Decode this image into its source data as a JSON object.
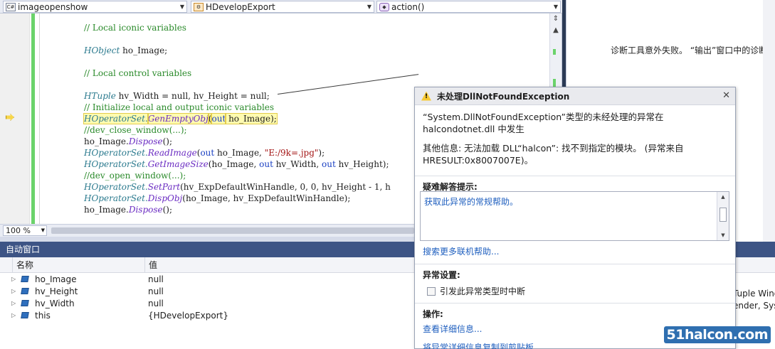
{
  "navbar": {
    "project": "imageopenshow",
    "class": "HDevelopExport",
    "method": "action()"
  },
  "editor": {
    "code_lines": [
      [
        {
          "t": "// Local iconic variables",
          "c": "cm"
        }
      ],
      [],
      [
        {
          "t": "HObject",
          "c": "ty"
        },
        {
          "t": " ho_Image;",
          "c": ""
        }
      ],
      [],
      [
        {
          "t": "// Local control variables",
          "c": "cm"
        }
      ],
      [],
      [
        {
          "t": "HTuple",
          "c": "ty"
        },
        {
          "t": " hv_Width = null, hv_Height = null;",
          "c": ""
        }
      ],
      [
        {
          "t": "// Initialize local and output iconic variables",
          "c": "cm"
        }
      ],
      [
        {
          "t": "HOperatorSet.",
          "c": "ty hl"
        },
        {
          "t": "GenEmptyObj",
          "c": "fn hl"
        },
        {
          "t": "(",
          "c": "hl"
        },
        {
          "t": "out",
          "c": "kw hl"
        },
        {
          "t": " ho_Image);",
          "c": "hl"
        }
      ],
      [
        {
          "t": "//dev_close_window(...);",
          "c": "cm"
        }
      ],
      [
        {
          "t": "ho_Image.",
          "c": ""
        },
        {
          "t": "Dispose",
          "c": "fn"
        },
        {
          "t": "();",
          "c": ""
        }
      ],
      [
        {
          "t": "HOperatorSet.",
          "c": "ty"
        },
        {
          "t": "ReadImage",
          "c": "fn"
        },
        {
          "t": "(",
          "c": ""
        },
        {
          "t": "out",
          "c": "kw"
        },
        {
          "t": " ho_Image, ",
          "c": ""
        },
        {
          "t": "\"E:/9k=.jpg\"",
          "c": "st"
        },
        {
          "t": ");",
          "c": ""
        }
      ],
      [
        {
          "t": "HOperatorSet.",
          "c": "ty"
        },
        {
          "t": "GetImageSize",
          "c": "fn"
        },
        {
          "t": "(ho_Image, ",
          "c": ""
        },
        {
          "t": "out",
          "c": "kw"
        },
        {
          "t": " hv_Width, ",
          "c": ""
        },
        {
          "t": "out",
          "c": "kw"
        },
        {
          "t": " hv_Height);",
          "c": ""
        }
      ],
      [
        {
          "t": "//dev_open_window(...);",
          "c": "cm"
        }
      ],
      [
        {
          "t": "HOperatorSet.",
          "c": "ty"
        },
        {
          "t": "SetPart",
          "c": "fn"
        },
        {
          "t": "(hv_ExpDefaultWinHandle, 0, 0, hv_Height - 1, h",
          "c": ""
        }
      ],
      [
        {
          "t": "HOperatorSet.",
          "c": "ty"
        },
        {
          "t": "DispObj",
          "c": "fn"
        },
        {
          "t": "(ho_Image, hv_ExpDefaultWinHandle);",
          "c": ""
        }
      ],
      [
        {
          "t": "ho_Image.",
          "c": ""
        },
        {
          "t": "Dispose",
          "c": "fn"
        },
        {
          "t": "();",
          "c": ""
        }
      ]
    ],
    "zoom": "100 %"
  },
  "right_pane": {
    "diagnostic_text": "诊断工具意外失败。 “输出”窗口中的诊断"
  },
  "autos": {
    "title": "自动窗口",
    "col_name": "名称",
    "col_value": "值",
    "rows": [
      {
        "name": "ho_Image",
        "value": "null"
      },
      {
        "name": "hv_Height",
        "value": "null"
      },
      {
        "name": "hv_Width",
        "value": "null"
      },
      {
        "name": "this",
        "value": "{HDevelopExport}"
      }
    ],
    "right_fragments": [
      "Tuple Wind",
      "ender, Syst"
    ]
  },
  "dialog": {
    "title": "未处理DllNotFoundException",
    "message1": "“System.DllNotFoundException”类型的未经处理的异常在 halcondotnet.dll 中发生",
    "message2": "其他信息: 无法加载 DLL“halcon”: 找不到指定的模块。 (异常来自 HRESULT:0x8007007E)。",
    "tips_title": "疑难解答提示:",
    "tips_link": "获取此异常的常规帮助。",
    "search_link": "搜索更多联机帮助...",
    "exception_settings_title": "异常设置:",
    "break_checkbox_label": "引发此异常类型时中断",
    "actions_title": "操作:",
    "details_link": "查看详细信息...",
    "copy_link": "将异常详细信息复制到剪贴板"
  },
  "watermark": "51halcon.com"
}
